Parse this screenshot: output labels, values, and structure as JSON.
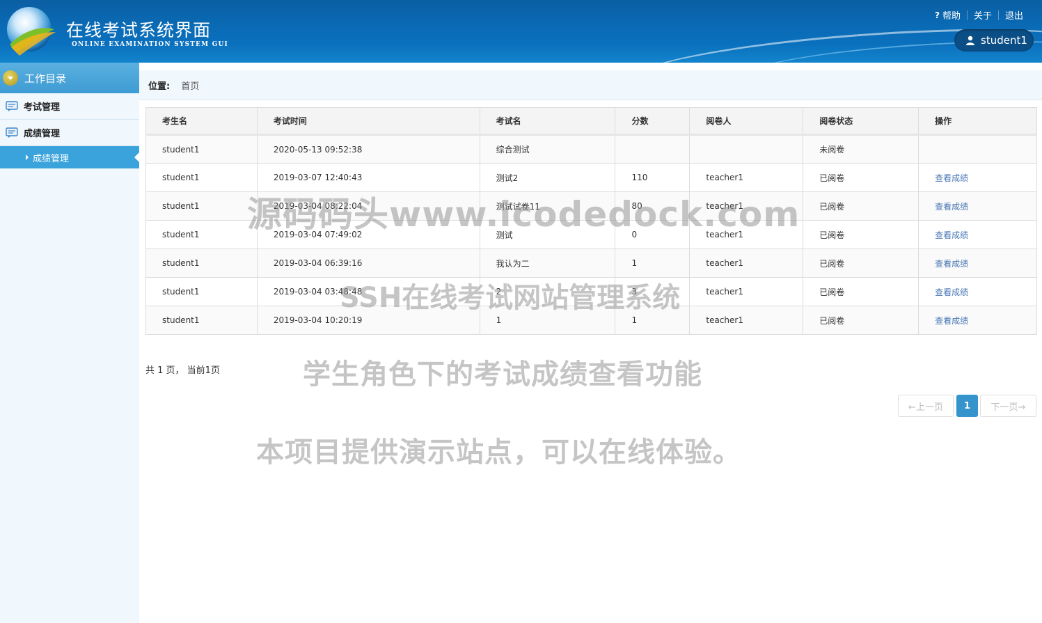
{
  "header": {
    "title": "在线考试系统界面",
    "subtitle": "ONLINE EXAMINATION SYSTEM GUI",
    "links": [
      "帮助",
      "关于",
      "退出"
    ],
    "user": "student1"
  },
  "sidebar": {
    "heading": "工作目录",
    "items": [
      "考试管理",
      "成绩管理"
    ],
    "active_sub": "成绩管理"
  },
  "breadcrumb": {
    "label": "位置:",
    "home": "首页"
  },
  "table": {
    "headers": [
      "考生名",
      "考试时间",
      "考试名",
      "分数",
      "阅卷人",
      "阅卷状态",
      "操作"
    ],
    "rows": [
      [
        "student1",
        "2020-05-13 09:52:38",
        "综合测试",
        "",
        "",
        "未阅卷",
        ""
      ],
      [
        "student1",
        "2019-03-07 12:40:43",
        "测试2",
        "110",
        "teacher1",
        "已阅卷",
        "查看成绩"
      ],
      [
        "student1",
        "2019-03-04 08:22:04",
        "测试试卷11",
        "80",
        "teacher1",
        "已阅卷",
        "查看成绩"
      ],
      [
        "student1",
        "2019-03-04 07:49:02",
        "测试",
        "0",
        "teacher1",
        "已阅卷",
        "查看成绩"
      ],
      [
        "student1",
        "2019-03-04 06:39:16",
        "我认为二",
        "1",
        "teacher1",
        "已阅卷",
        "查看成绩"
      ],
      [
        "student1",
        "2019-03-04 03:48:48",
        "2",
        "3",
        "teacher1",
        "已阅卷",
        "查看成绩"
      ],
      [
        "student1",
        "2019-03-04 10:20:19",
        "1",
        "1",
        "teacher1",
        "已阅卷",
        "查看成绩"
      ]
    ]
  },
  "pagination": {
    "info": "共 1 页， 当前1页",
    "prev": "←上一页",
    "current": "1",
    "next": "下一页→"
  },
  "watermarks": [
    "源码码头www.icodedock.com",
    "SSH在线考试网站管理系统",
    "学生角色下的考试成绩查看功能",
    "本项目提供演示站点，可以在线体验。"
  ],
  "colors": {
    "header": "#0a6bb6",
    "accent": "#3aa3dc",
    "link": "#4a78b5",
    "active_page": "#3494cb"
  }
}
